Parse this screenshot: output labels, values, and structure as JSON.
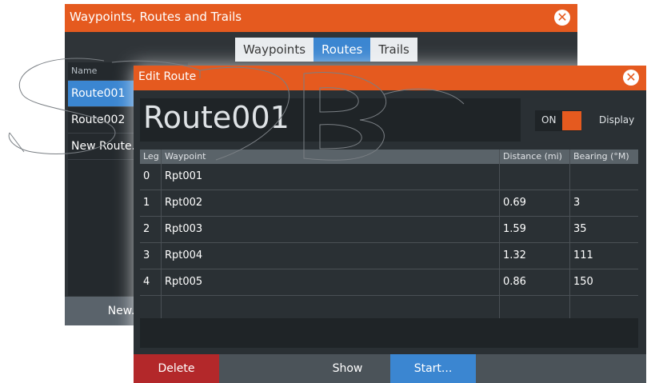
{
  "back_window": {
    "title": "Waypoints, Routes and Trails",
    "close_glyph": "✕",
    "tabs": [
      {
        "label": "Waypoints",
        "active": false
      },
      {
        "label": "Routes",
        "active": true
      },
      {
        "label": "Trails",
        "active": false
      }
    ],
    "list_header": "Name",
    "items": [
      "Route001",
      "Route002",
      "New Route.."
    ],
    "new_button": "New..."
  },
  "dialog": {
    "title": "Edit Route",
    "close_glyph": "✕",
    "route_name": "Route001",
    "toggle_label": "ON",
    "display_label": "Display",
    "columns": {
      "leg": "Leg",
      "waypoint": "Waypoint",
      "distance": "Distance (mi)",
      "bearing": "Bearing (°M)"
    },
    "rows": [
      {
        "leg": "0",
        "waypoint": "Rpt001",
        "distance": "",
        "bearing": ""
      },
      {
        "leg": "1",
        "waypoint": "Rpt002",
        "distance": "0.69",
        "bearing": "3"
      },
      {
        "leg": "2",
        "waypoint": "Rpt003",
        "distance": "1.59",
        "bearing": "35"
      },
      {
        "leg": "3",
        "waypoint": "Rpt004",
        "distance": "1.32",
        "bearing": "111"
      },
      {
        "leg": "4",
        "waypoint": "Rpt005",
        "distance": "0.86",
        "bearing": "150"
      },
      {
        "leg": "",
        "waypoint": "",
        "distance": "",
        "bearing": ""
      }
    ],
    "buttons": {
      "delete": "Delete",
      "show": "Show",
      "start": "Start..."
    }
  },
  "colors": {
    "accent": "#e55a1f",
    "selected": "#3b86d1",
    "danger": "#b3282a"
  }
}
